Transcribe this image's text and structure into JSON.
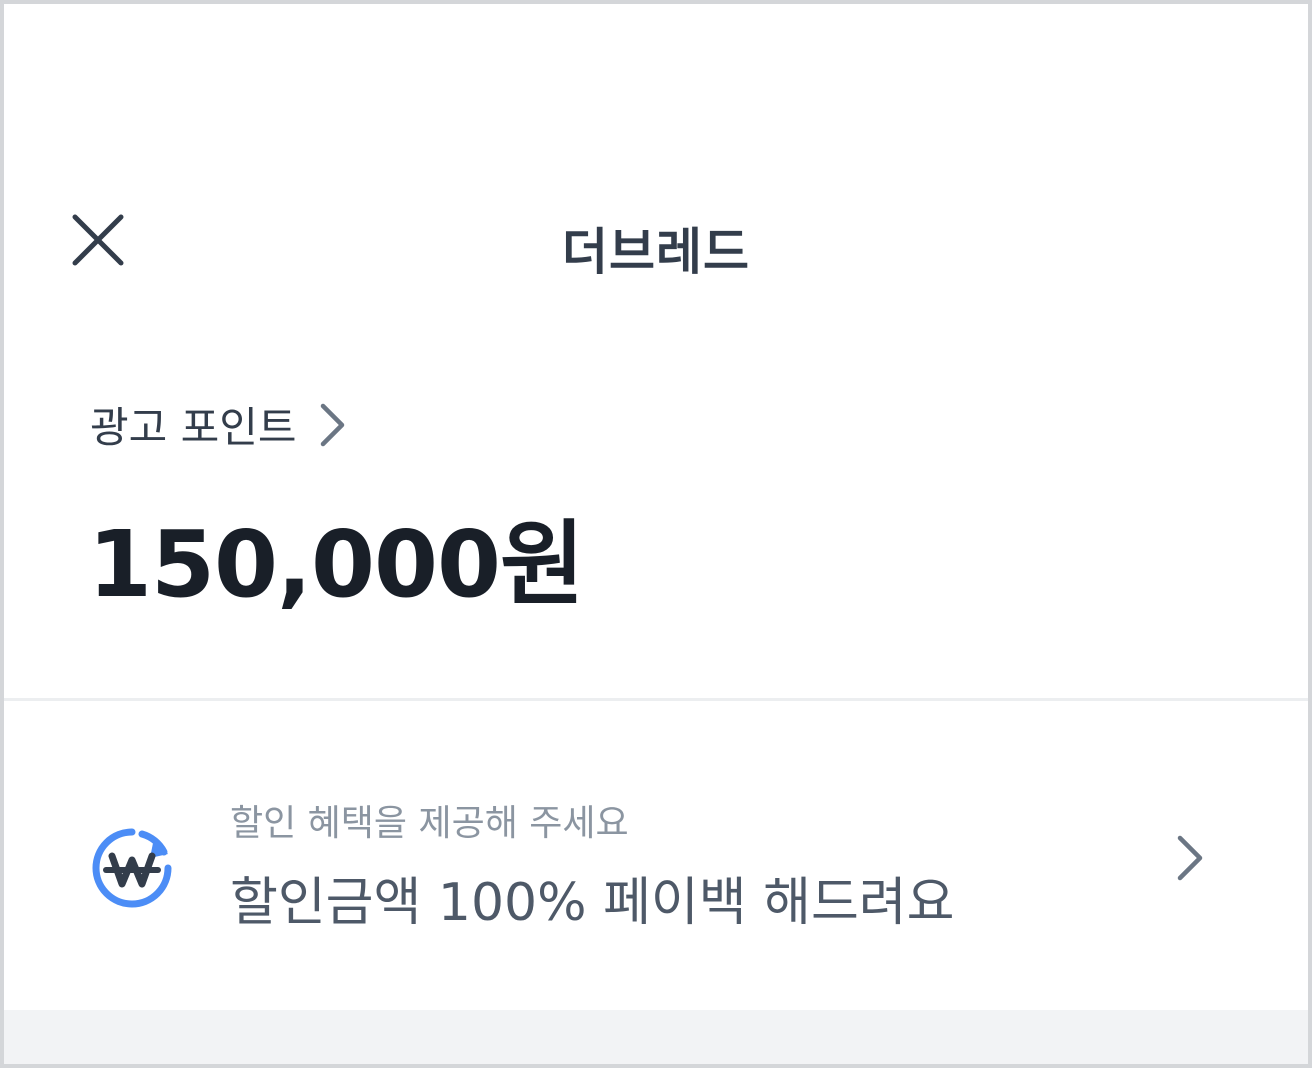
{
  "header": {
    "title": "더브레드"
  },
  "points": {
    "label": "광고 포인트",
    "amount": "150,000원"
  },
  "promo": {
    "subtitle": "할인 혜택을 제공해 주세요",
    "title": "할인금액 100% 페이백 해드려요"
  },
  "icons": {
    "close": "close-icon",
    "points_chevron": "chevron-right-icon",
    "promo_icon": "won-cashback-icon",
    "promo_chevron": "chevron-right-icon"
  },
  "colors": {
    "accent_blue": "#4c8df6",
    "title_text": "#333d4b",
    "amount_text": "#191f28",
    "sub_text": "#8b95a1",
    "body_text": "#4e5968",
    "bottom_band": "#f2f3f5"
  }
}
